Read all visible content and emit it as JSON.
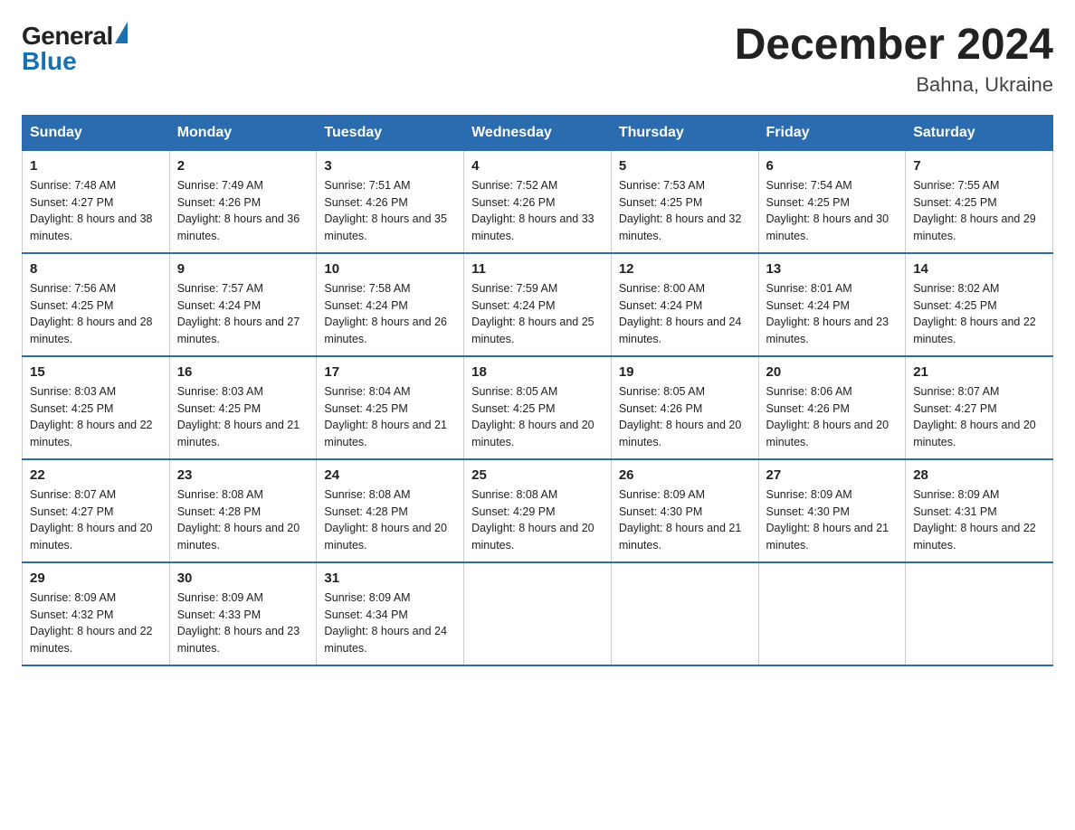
{
  "logo": {
    "general": "General",
    "blue": "Blue"
  },
  "title": "December 2024",
  "subtitle": "Bahna, Ukraine",
  "weekdays": [
    "Sunday",
    "Monday",
    "Tuesday",
    "Wednesday",
    "Thursday",
    "Friday",
    "Saturday"
  ],
  "weeks": [
    [
      {
        "day": "1",
        "sunrise": "7:48 AM",
        "sunset": "4:27 PM",
        "daylight": "8 hours and 38 minutes."
      },
      {
        "day": "2",
        "sunrise": "7:49 AM",
        "sunset": "4:26 PM",
        "daylight": "8 hours and 36 minutes."
      },
      {
        "day": "3",
        "sunrise": "7:51 AM",
        "sunset": "4:26 PM",
        "daylight": "8 hours and 35 minutes."
      },
      {
        "day": "4",
        "sunrise": "7:52 AM",
        "sunset": "4:26 PM",
        "daylight": "8 hours and 33 minutes."
      },
      {
        "day": "5",
        "sunrise": "7:53 AM",
        "sunset": "4:25 PM",
        "daylight": "8 hours and 32 minutes."
      },
      {
        "day": "6",
        "sunrise": "7:54 AM",
        "sunset": "4:25 PM",
        "daylight": "8 hours and 30 minutes."
      },
      {
        "day": "7",
        "sunrise": "7:55 AM",
        "sunset": "4:25 PM",
        "daylight": "8 hours and 29 minutes."
      }
    ],
    [
      {
        "day": "8",
        "sunrise": "7:56 AM",
        "sunset": "4:25 PM",
        "daylight": "8 hours and 28 minutes."
      },
      {
        "day": "9",
        "sunrise": "7:57 AM",
        "sunset": "4:24 PM",
        "daylight": "8 hours and 27 minutes."
      },
      {
        "day": "10",
        "sunrise": "7:58 AM",
        "sunset": "4:24 PM",
        "daylight": "8 hours and 26 minutes."
      },
      {
        "day": "11",
        "sunrise": "7:59 AM",
        "sunset": "4:24 PM",
        "daylight": "8 hours and 25 minutes."
      },
      {
        "day": "12",
        "sunrise": "8:00 AM",
        "sunset": "4:24 PM",
        "daylight": "8 hours and 24 minutes."
      },
      {
        "day": "13",
        "sunrise": "8:01 AM",
        "sunset": "4:24 PM",
        "daylight": "8 hours and 23 minutes."
      },
      {
        "day": "14",
        "sunrise": "8:02 AM",
        "sunset": "4:25 PM",
        "daylight": "8 hours and 22 minutes."
      }
    ],
    [
      {
        "day": "15",
        "sunrise": "8:03 AM",
        "sunset": "4:25 PM",
        "daylight": "8 hours and 22 minutes."
      },
      {
        "day": "16",
        "sunrise": "8:03 AM",
        "sunset": "4:25 PM",
        "daylight": "8 hours and 21 minutes."
      },
      {
        "day": "17",
        "sunrise": "8:04 AM",
        "sunset": "4:25 PM",
        "daylight": "8 hours and 21 minutes."
      },
      {
        "day": "18",
        "sunrise": "8:05 AM",
        "sunset": "4:25 PM",
        "daylight": "8 hours and 20 minutes."
      },
      {
        "day": "19",
        "sunrise": "8:05 AM",
        "sunset": "4:26 PM",
        "daylight": "8 hours and 20 minutes."
      },
      {
        "day": "20",
        "sunrise": "8:06 AM",
        "sunset": "4:26 PM",
        "daylight": "8 hours and 20 minutes."
      },
      {
        "day": "21",
        "sunrise": "8:07 AM",
        "sunset": "4:27 PM",
        "daylight": "8 hours and 20 minutes."
      }
    ],
    [
      {
        "day": "22",
        "sunrise": "8:07 AM",
        "sunset": "4:27 PM",
        "daylight": "8 hours and 20 minutes."
      },
      {
        "day": "23",
        "sunrise": "8:08 AM",
        "sunset": "4:28 PM",
        "daylight": "8 hours and 20 minutes."
      },
      {
        "day": "24",
        "sunrise": "8:08 AM",
        "sunset": "4:28 PM",
        "daylight": "8 hours and 20 minutes."
      },
      {
        "day": "25",
        "sunrise": "8:08 AM",
        "sunset": "4:29 PM",
        "daylight": "8 hours and 20 minutes."
      },
      {
        "day": "26",
        "sunrise": "8:09 AM",
        "sunset": "4:30 PM",
        "daylight": "8 hours and 21 minutes."
      },
      {
        "day": "27",
        "sunrise": "8:09 AM",
        "sunset": "4:30 PM",
        "daylight": "8 hours and 21 minutes."
      },
      {
        "day": "28",
        "sunrise": "8:09 AM",
        "sunset": "4:31 PM",
        "daylight": "8 hours and 22 minutes."
      }
    ],
    [
      {
        "day": "29",
        "sunrise": "8:09 AM",
        "sunset": "4:32 PM",
        "daylight": "8 hours and 22 minutes."
      },
      {
        "day": "30",
        "sunrise": "8:09 AM",
        "sunset": "4:33 PM",
        "daylight": "8 hours and 23 minutes."
      },
      {
        "day": "31",
        "sunrise": "8:09 AM",
        "sunset": "4:34 PM",
        "daylight": "8 hours and 24 minutes."
      },
      null,
      null,
      null,
      null
    ]
  ]
}
